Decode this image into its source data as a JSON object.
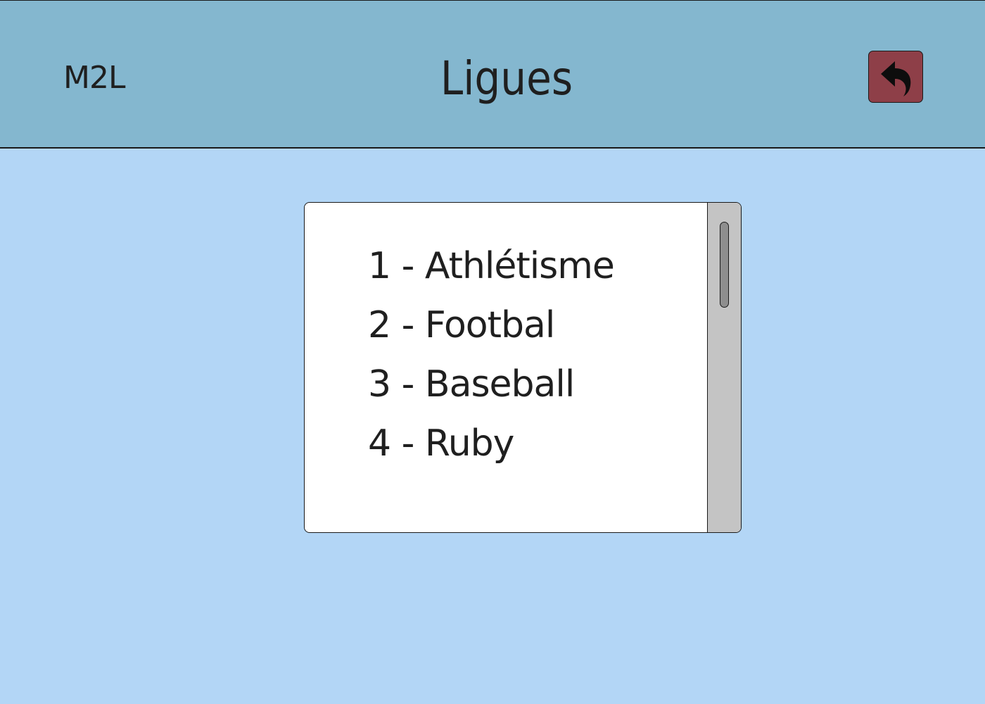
{
  "header": {
    "brand": "M2L",
    "title": "Ligues",
    "back_icon": "back-arrow-icon"
  },
  "colors": {
    "header_bg": "#84b7cf",
    "page_bg": "#b3d6f6",
    "back_button_bg": "#8e3f48",
    "panel_bg": "#ffffff",
    "scrollbar_bg": "#c4c4c4"
  },
  "leagues": {
    "items": [
      {
        "label": "1 - Athlétisme"
      },
      {
        "label": "2 - Footbal"
      },
      {
        "label": "3 - Baseball"
      },
      {
        "label": "4 - Ruby"
      }
    ]
  }
}
